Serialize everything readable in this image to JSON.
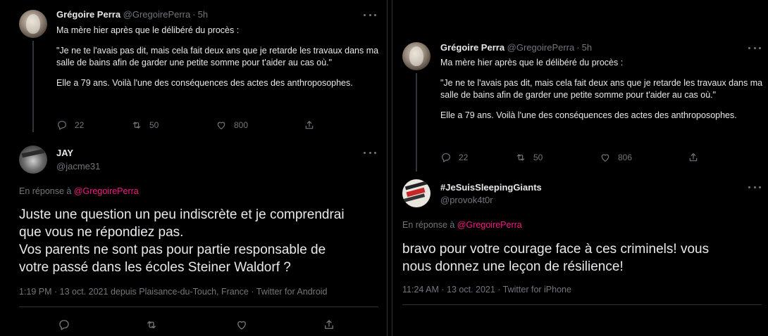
{
  "left": {
    "tweet": {
      "name": "Grégoire Perra",
      "handle": "@GregoirePerra",
      "time": "5h",
      "paragraphs": [
        "Ma mère hier après que le délibéré du procès :",
        "\"Je ne te l'avais pas dit, mais cela fait deux ans que je retarde les travaux dans ma salle de bains afin de garder une petite somme pour t'aider au cas où.\"",
        "Elle a 79 ans. Voilà l'une des conséquences des actes des anthroposophes."
      ],
      "replies": "22",
      "retweets": "50",
      "likes": "800"
    },
    "reply": {
      "name": "JAY",
      "handle": "@jacme31",
      "reply_prefix": "En réponse à",
      "reply_to": "@GregoirePerra",
      "text_lines": [
        "Juste une question un peu indiscrète et  je comprendrai",
        "que vous ne répondiez pas.",
        "Vos parents ne sont pas pour partie responsable de",
        "votre passé dans les écoles Steiner Waldorf ?"
      ],
      "meta": "1:19 PM · 13 oct. 2021 depuis Plaisance-du-Touch, France · Twitter for Android"
    }
  },
  "right": {
    "tweet": {
      "name": "Grégoire Perra",
      "handle": "@GregoirePerra",
      "time": "5h",
      "paragraphs": [
        "Ma mère hier après que le délibéré du procès :",
        "\"Je ne te l'avais pas dit, mais cela fait deux ans que je retarde les travaux dans ma salle de bains afin de garder une petite somme pour t'aider au cas où.\"",
        "Elle a 79 ans. Voilà l'une des conséquences des actes des anthroposophes."
      ],
      "replies": "22",
      "retweets": "50",
      "likes": "806"
    },
    "reply": {
      "name": "#JeSuisSleepingGiants",
      "handle": "@provok4t0r",
      "reply_prefix": "En réponse à",
      "reply_to": "@GregoirePerra",
      "text_lines": [
        "bravo pour votre courage face à ces criminels! vous",
        "nous donnez une leçon de résilience!"
      ],
      "meta": "11:24 AM · 13 oct. 2021 · Twitter for iPhone"
    }
  },
  "icons": {
    "reply": "reply-icon",
    "retweet": "retweet-icon",
    "like": "like-icon",
    "share": "share-icon",
    "more": "more-icon"
  },
  "colors": {
    "background": "#000000",
    "text": "#e7e9ea",
    "muted": "#71767b",
    "mention": "#f91880",
    "border": "#2f3336"
  }
}
